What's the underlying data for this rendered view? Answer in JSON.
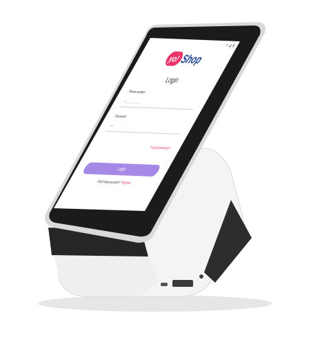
{
  "status": {
    "icons_text": "▾ ◢ ▮"
  },
  "logo": {
    "badge": "yo!",
    "name": "Shop"
  },
  "login": {
    "title": "Login",
    "phone_label": "Phone number",
    "phone_value": "+1 ___ ___ ____",
    "password_label": "Password",
    "password_placeholder": "••••",
    "forgot": "Forgot password?",
    "button": "Login",
    "no_account": "Don't have account?",
    "register": "Register"
  },
  "colors": {
    "accent_pink": "#e9356a",
    "brand_blue": "#1d3f8f",
    "button_purple": "#a689e6"
  }
}
